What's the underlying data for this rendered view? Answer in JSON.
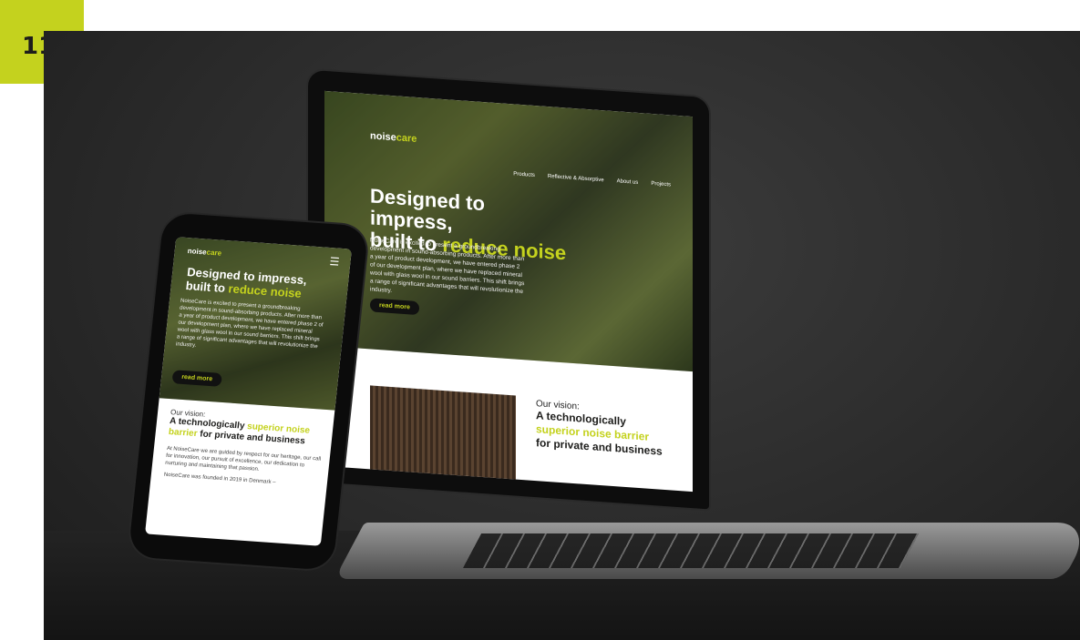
{
  "badge": {
    "number": "11"
  },
  "laptop": {
    "logo": {
      "part1": "noise",
      "part2": "care"
    },
    "nav": [
      "Products",
      "Reflective & Absorptive",
      "About us",
      "Projects"
    ],
    "hero": {
      "title_line1": "Designed to impress,",
      "title_prefix": "built to ",
      "title_highlight": "reduce noise",
      "text": "NoiseCare is excited to present a groundbreaking development in sound-absorbing products. After more than a year of product development, we have entered phase 2 of our development plan, where we have replaced mineral wool with glass wool in our sound barriers. This shift brings a range of significant advantages that will revolutionize the industry.",
      "button": "read more"
    },
    "vision": {
      "label": "Our vision:",
      "head_line1": "A technologically",
      "head_highlight": "superior noise barrier",
      "head_line3": "for private and business"
    }
  },
  "phone": {
    "logo": {
      "part1": "noise",
      "part2": "care"
    },
    "menu_icon": "hamburger-icon",
    "hero": {
      "title_line1": "Designed to impress,",
      "title_prefix": "built to ",
      "title_highlight": "reduce noise",
      "text": "NoiseCare is excited to present a groundbreaking development in sound-absorbing products. After more than a year of product development, we have entered phase 2 of our development plan, where we have replaced mineral wool with glass wool in our sound barriers. This shift brings a range of significant advantages that will revolutionize the industry.",
      "button": "read more"
    },
    "vision": {
      "label": "Our vision:",
      "head_prefix": "A technologically ",
      "head_highlight": "superior noise barrier",
      "head_suffix": " for private and business",
      "text": "At NoiseCare we are guided by respect for our heritage, our call for innovation, our pursuit of excellence, our dedication to nurturing and maintaining that passion.",
      "footer": "NoiseCare was founded in 2019 in Denmark –"
    }
  },
  "colors": {
    "accent": "#c4d21e",
    "background": "#2e2e2e"
  }
}
